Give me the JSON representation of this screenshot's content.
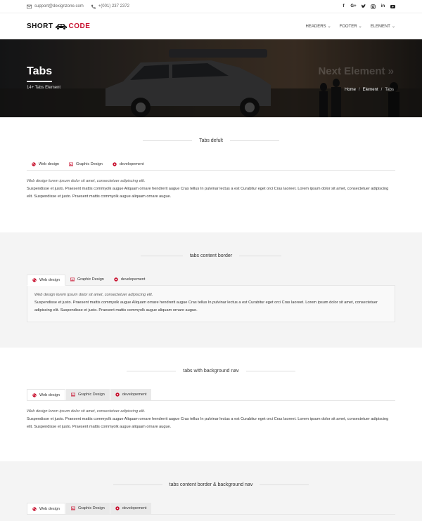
{
  "topbar": {
    "email": "support@dexignzone.com",
    "phone": "+(001) 237 2372",
    "social": [
      "f",
      "G+",
      "t",
      "ig",
      "in",
      "yt"
    ]
  },
  "header": {
    "logo_left": "SHORT",
    "logo_right": "CODE",
    "nav": [
      "HEADERS",
      "FOOTER",
      "ELEMENT"
    ]
  },
  "hero": {
    "title": "Tabs",
    "subtitle": "14+ Tabs Element",
    "next": "Next Element »",
    "breadcrumb": [
      "Home",
      "Element",
      "Tabs"
    ]
  },
  "tabs": [
    "Web design",
    "Graphic Design",
    "developement"
  ],
  "content": {
    "lead": "Web design lorem ipsum dolor sit amet, consectetuer adipiscing elit.",
    "body": "Suspendisse et justo. Praesent mattis commyolk augue Aliquam ornare hendrerit augue Cras tellus In pulvinar lectus a est Curabitur eget orci Cras laoreet. Lorem ipsum dolor sit amet, consectetuer adipiscing elit. Suspendisse et justo. Praesent mattis commyolk augue aliquam ornare augue."
  },
  "sections": [
    "Tabs defult",
    "tabs content border",
    "tabs with background nav",
    "tabs content border & background nav"
  ],
  "colors": {
    "accent": "#c8102e"
  }
}
